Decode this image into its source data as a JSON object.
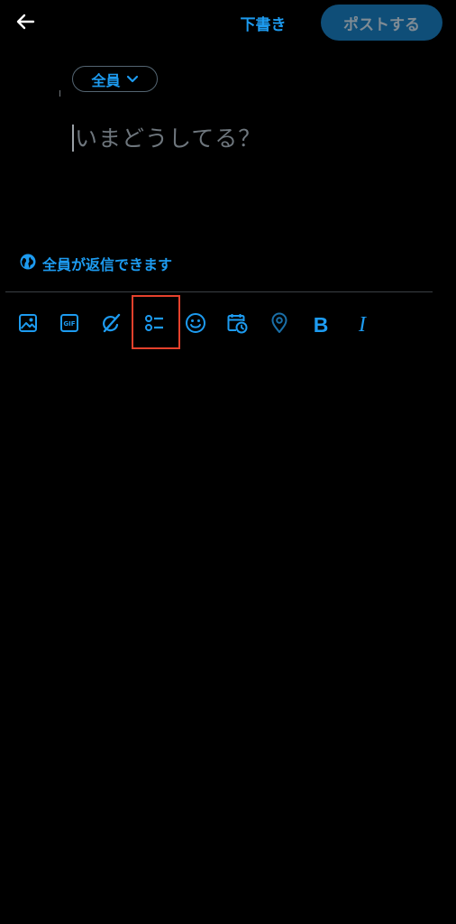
{
  "header": {
    "back_icon": "arrow-left-icon",
    "drafts_label": "下書き",
    "post_label": "ポストする"
  },
  "audience": {
    "label": "全員",
    "icon": "chevron-down-icon"
  },
  "compose": {
    "placeholder": "いまどうしてる？"
  },
  "reply_setting": {
    "icon": "globe-icon",
    "label": "全員が返信できます"
  },
  "toolbar": {
    "items": [
      {
        "name": "image",
        "icon": "image-icon"
      },
      {
        "name": "gif",
        "icon": "gif-icon",
        "text": "GIF"
      },
      {
        "name": "grok",
        "icon": "grok-icon"
      },
      {
        "name": "poll",
        "icon": "poll-icon"
      },
      {
        "name": "emoji",
        "icon": "emoji-icon"
      },
      {
        "name": "schedule",
        "icon": "schedule-icon"
      },
      {
        "name": "location",
        "icon": "location-icon"
      },
      {
        "name": "bold",
        "icon": "bold-icon",
        "text": "B"
      },
      {
        "name": "italic",
        "icon": "italic-icon",
        "text": "I"
      }
    ]
  },
  "colors": {
    "background": "#000000",
    "accent": "#1d9bf0",
    "post_button_bg": "#0f4e78",
    "post_button_text": "#7f8b94",
    "placeholder": "#6e767d",
    "highlight": "#e5412c",
    "divider": "#3a3f44"
  }
}
